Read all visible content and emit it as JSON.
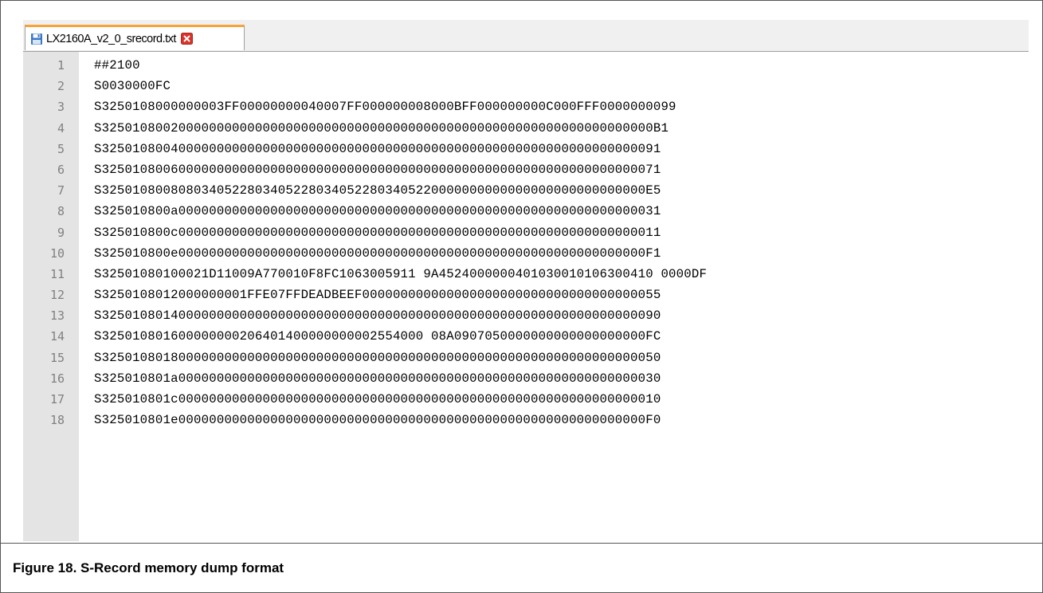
{
  "tab": {
    "filename": "LX2160A_v2_0_srecord.txt",
    "icon": "floppy-save-icon",
    "close_icon": "close-icon"
  },
  "colors": {
    "tab_accent": "#f8a23a",
    "close_red": "#d9342b",
    "gutter_bg": "#e4e4e4",
    "line_number": "#808080"
  },
  "editor": {
    "lines": [
      {
        "number": "1",
        "text": "##2100"
      },
      {
        "number": "2",
        "text": "S0030000FC"
      },
      {
        "number": "3",
        "text": "S3250108000000003FF00000000040007FF000000008000BFF000000000C000FFF0000000099"
      },
      {
        "number": "4",
        "text": "S325010800200000000000000000000000000000000000000000000000000000000000000B1"
      },
      {
        "number": "5",
        "text": "S3250108004000000000000000000000000000000000000000000000000000000000000091"
      },
      {
        "number": "6",
        "text": "S3250108006000000000000000000000000000000000000000000000000000000000000071"
      },
      {
        "number": "7",
        "text": "S32501080080803405228034052280340522803405220000000000000000000000000000E5"
      },
      {
        "number": "8",
        "text": "S325010800a000000000000000000000000000000000000000000000000000000000000031"
      },
      {
        "number": "9",
        "text": "S325010800c000000000000000000000000000000000000000000000000000000000000011"
      },
      {
        "number": "10",
        "text": "S325010800e0000000000000000000000000000000000000000000000000000000000000F1"
      },
      {
        "number": "11",
        "text": "S32501080100021D11009A770010F8FC1063005911 9A4524000000401030010106300410 0000DF"
      },
      {
        "number": "12",
        "text": "S3250108012000000001FFE07FFDEADBEEF000000000000000000000000000000000000055"
      },
      {
        "number": "13",
        "text": "S3250108014000000000000000000000000000000000000000000000000000000000000090"
      },
      {
        "number": "14",
        "text": "S325010801600000000206401400000000002554000 08A0907050000000000000000000FC"
      },
      {
        "number": "15",
        "text": "S3250108018000000000000000000000000000000000000000000000000000000000000050"
      },
      {
        "number": "16",
        "text": "S325010801a000000000000000000000000000000000000000000000000000000000000030"
      },
      {
        "number": "17",
        "text": "S325010801c000000000000000000000000000000000000000000000000000000000000010"
      },
      {
        "number": "18",
        "text": "S325010801e0000000000000000000000000000000000000000000000000000000000000F0"
      }
    ]
  },
  "caption": {
    "text": "Figure 18.  S-Record memory dump format"
  }
}
